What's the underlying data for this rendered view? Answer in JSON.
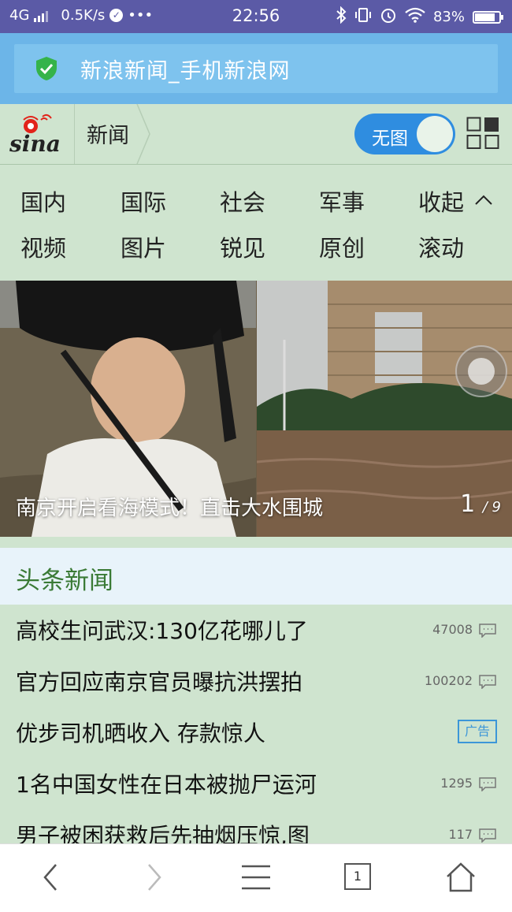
{
  "status_bar": {
    "network": "4G",
    "speed": "0.5K/s",
    "more": "•••",
    "time": "22:56",
    "battery": "83%",
    "battery_level": 0.83
  },
  "browser": {
    "page_title": "新浪新闻_手机新浪网"
  },
  "header": {
    "logo_text": "sina",
    "section": "新闻",
    "toggle_label": "无图"
  },
  "channels": {
    "row1": [
      "国内",
      "国际",
      "社会",
      "军事",
      "收起"
    ],
    "row2": [
      "视频",
      "图片",
      "锐见",
      "原创",
      "滚动"
    ]
  },
  "hero": {
    "caption": "南京开启看海模式！直击大水围城",
    "current": "1",
    "total": "/ 9"
  },
  "headlines": {
    "title": "头条新闻",
    "items": [
      {
        "title": "高校生问武汉:130亿花哪儿了",
        "count": "47008"
      },
      {
        "title": "官方回应南京官员曝抗洪摆拍",
        "count": "100202"
      },
      {
        "title": "优步司机晒收入 存款惊人",
        "badge": "广告"
      },
      {
        "title": "1名中国女性在日本被抛尸运河",
        "count": "1295"
      },
      {
        "title": "男子被困获救后先抽烟压惊,图",
        "count": "117"
      }
    ]
  },
  "bottom_nav": {
    "tab_count": "1"
  },
  "colors": {
    "status_bar": "#5b5aa6",
    "address_bar": "#6cb5e8",
    "page_bg": "#cfe4cf",
    "toggle": "#2f8de0",
    "headline_green": "#3a7a35"
  }
}
